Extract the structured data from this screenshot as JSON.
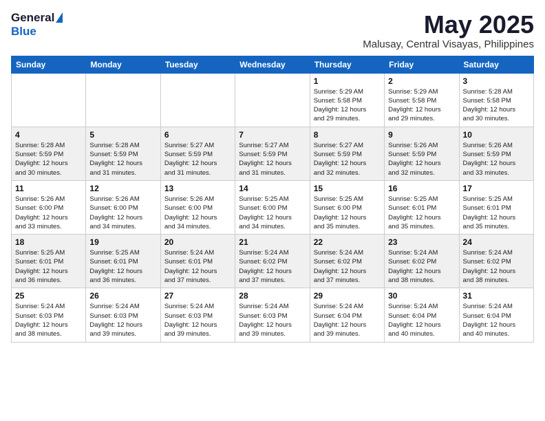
{
  "header": {
    "logo_general": "General",
    "logo_blue": "Blue",
    "title": "May 2025",
    "subtitle": "Malusay, Central Visayas, Philippines"
  },
  "calendar": {
    "days_of_week": [
      "Sunday",
      "Monday",
      "Tuesday",
      "Wednesday",
      "Thursday",
      "Friday",
      "Saturday"
    ],
    "weeks": [
      [
        {
          "day": "",
          "info": ""
        },
        {
          "day": "",
          "info": ""
        },
        {
          "day": "",
          "info": ""
        },
        {
          "day": "",
          "info": ""
        },
        {
          "day": "1",
          "info": "Sunrise: 5:29 AM\nSunset: 5:58 PM\nDaylight: 12 hours\nand 29 minutes."
        },
        {
          "day": "2",
          "info": "Sunrise: 5:29 AM\nSunset: 5:58 PM\nDaylight: 12 hours\nand 29 minutes."
        },
        {
          "day": "3",
          "info": "Sunrise: 5:28 AM\nSunset: 5:58 PM\nDaylight: 12 hours\nand 30 minutes."
        }
      ],
      [
        {
          "day": "4",
          "info": "Sunrise: 5:28 AM\nSunset: 5:59 PM\nDaylight: 12 hours\nand 30 minutes."
        },
        {
          "day": "5",
          "info": "Sunrise: 5:28 AM\nSunset: 5:59 PM\nDaylight: 12 hours\nand 31 minutes."
        },
        {
          "day": "6",
          "info": "Sunrise: 5:27 AM\nSunset: 5:59 PM\nDaylight: 12 hours\nand 31 minutes."
        },
        {
          "day": "7",
          "info": "Sunrise: 5:27 AM\nSunset: 5:59 PM\nDaylight: 12 hours\nand 31 minutes."
        },
        {
          "day": "8",
          "info": "Sunrise: 5:27 AM\nSunset: 5:59 PM\nDaylight: 12 hours\nand 32 minutes."
        },
        {
          "day": "9",
          "info": "Sunrise: 5:26 AM\nSunset: 5:59 PM\nDaylight: 12 hours\nand 32 minutes."
        },
        {
          "day": "10",
          "info": "Sunrise: 5:26 AM\nSunset: 5:59 PM\nDaylight: 12 hours\nand 33 minutes."
        }
      ],
      [
        {
          "day": "11",
          "info": "Sunrise: 5:26 AM\nSunset: 6:00 PM\nDaylight: 12 hours\nand 33 minutes."
        },
        {
          "day": "12",
          "info": "Sunrise: 5:26 AM\nSunset: 6:00 PM\nDaylight: 12 hours\nand 34 minutes."
        },
        {
          "day": "13",
          "info": "Sunrise: 5:26 AM\nSunset: 6:00 PM\nDaylight: 12 hours\nand 34 minutes."
        },
        {
          "day": "14",
          "info": "Sunrise: 5:25 AM\nSunset: 6:00 PM\nDaylight: 12 hours\nand 34 minutes."
        },
        {
          "day": "15",
          "info": "Sunrise: 5:25 AM\nSunset: 6:00 PM\nDaylight: 12 hours\nand 35 minutes."
        },
        {
          "day": "16",
          "info": "Sunrise: 5:25 AM\nSunset: 6:01 PM\nDaylight: 12 hours\nand 35 minutes."
        },
        {
          "day": "17",
          "info": "Sunrise: 5:25 AM\nSunset: 6:01 PM\nDaylight: 12 hours\nand 35 minutes."
        }
      ],
      [
        {
          "day": "18",
          "info": "Sunrise: 5:25 AM\nSunset: 6:01 PM\nDaylight: 12 hours\nand 36 minutes."
        },
        {
          "day": "19",
          "info": "Sunrise: 5:25 AM\nSunset: 6:01 PM\nDaylight: 12 hours\nand 36 minutes."
        },
        {
          "day": "20",
          "info": "Sunrise: 5:24 AM\nSunset: 6:01 PM\nDaylight: 12 hours\nand 37 minutes."
        },
        {
          "day": "21",
          "info": "Sunrise: 5:24 AM\nSunset: 6:02 PM\nDaylight: 12 hours\nand 37 minutes."
        },
        {
          "day": "22",
          "info": "Sunrise: 5:24 AM\nSunset: 6:02 PM\nDaylight: 12 hours\nand 37 minutes."
        },
        {
          "day": "23",
          "info": "Sunrise: 5:24 AM\nSunset: 6:02 PM\nDaylight: 12 hours\nand 38 minutes."
        },
        {
          "day": "24",
          "info": "Sunrise: 5:24 AM\nSunset: 6:02 PM\nDaylight: 12 hours\nand 38 minutes."
        }
      ],
      [
        {
          "day": "25",
          "info": "Sunrise: 5:24 AM\nSunset: 6:03 PM\nDaylight: 12 hours\nand 38 minutes."
        },
        {
          "day": "26",
          "info": "Sunrise: 5:24 AM\nSunset: 6:03 PM\nDaylight: 12 hours\nand 39 minutes."
        },
        {
          "day": "27",
          "info": "Sunrise: 5:24 AM\nSunset: 6:03 PM\nDaylight: 12 hours\nand 39 minutes."
        },
        {
          "day": "28",
          "info": "Sunrise: 5:24 AM\nSunset: 6:03 PM\nDaylight: 12 hours\nand 39 minutes."
        },
        {
          "day": "29",
          "info": "Sunrise: 5:24 AM\nSunset: 6:04 PM\nDaylight: 12 hours\nand 39 minutes."
        },
        {
          "day": "30",
          "info": "Sunrise: 5:24 AM\nSunset: 6:04 PM\nDaylight: 12 hours\nand 40 minutes."
        },
        {
          "day": "31",
          "info": "Sunrise: 5:24 AM\nSunset: 6:04 PM\nDaylight: 12 hours\nand 40 minutes."
        }
      ]
    ]
  }
}
